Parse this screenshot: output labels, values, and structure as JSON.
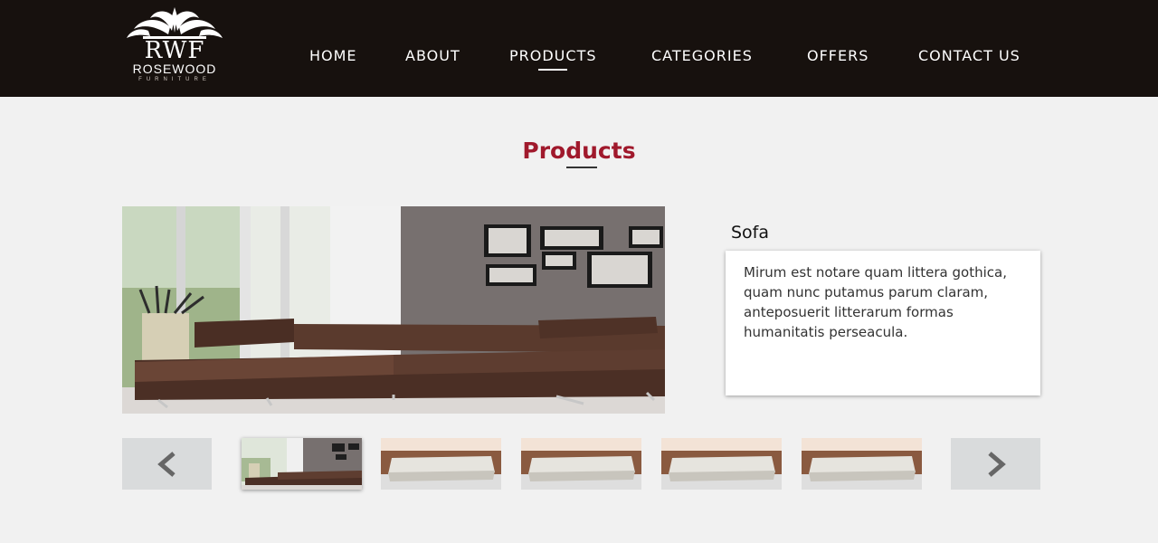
{
  "brand": {
    "monogram": "RWF",
    "name": "ROSEWOOD",
    "tagline": "FURNITURE"
  },
  "nav": {
    "items": [
      {
        "label": "HOME"
      },
      {
        "label": "ABOUT"
      },
      {
        "label": "PRODUCTS",
        "active": true
      },
      {
        "label": "CATEGORIES"
      },
      {
        "label": "OFFERS"
      },
      {
        "label": "CONTACT US"
      }
    ]
  },
  "section": {
    "title": "Products"
  },
  "product": {
    "name": "Sofa",
    "description": "Mirum est notare quam littera gothica, quam nunc putamus parum claram, anteposuerit litterarum formas humanitatis perseacula."
  },
  "carousel": {
    "prev_icon": "chevron-left-icon",
    "next_icon": "chevron-right-icon",
    "thumbnails": [
      {
        "subject": "sectional-sofa",
        "selected": true
      },
      {
        "subject": "ottoman"
      },
      {
        "subject": "ottoman"
      },
      {
        "subject": "ottoman"
      },
      {
        "subject": "ottoman"
      }
    ]
  },
  "colors": {
    "header_bg": "#17110e",
    "accent": "#a0192c",
    "page_bg": "#f1f1f1"
  }
}
